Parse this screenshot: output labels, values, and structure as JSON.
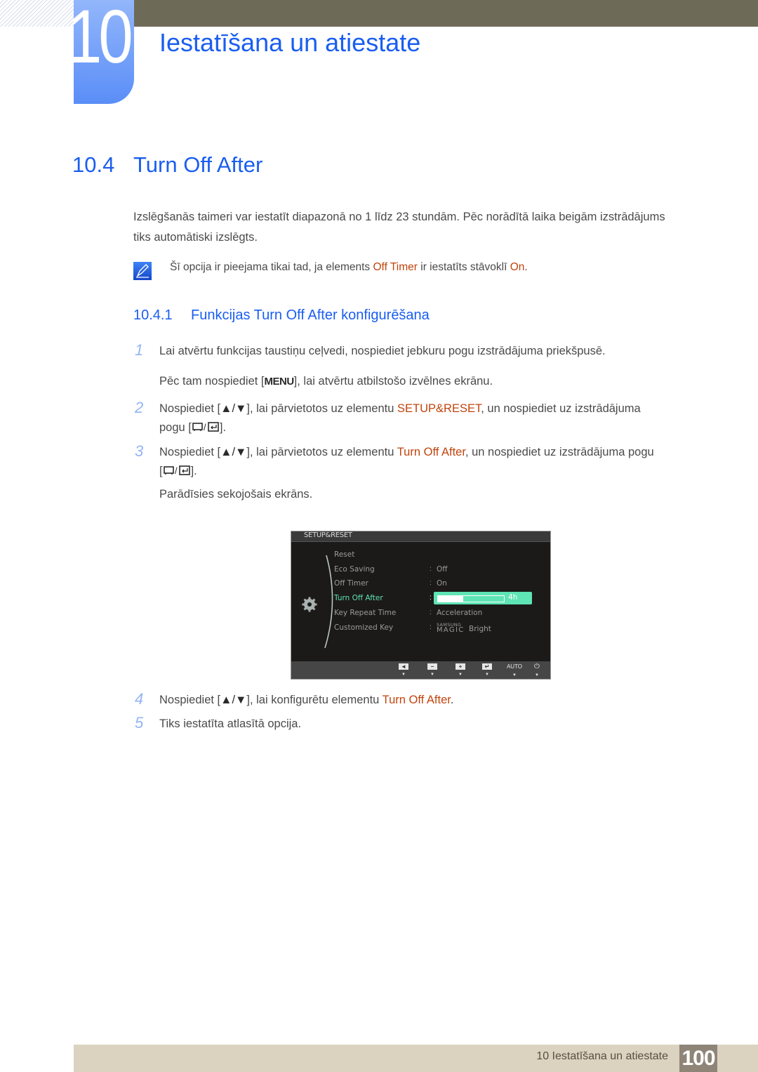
{
  "chapter": {
    "number": "10",
    "title": "Iestatīšana un atiestate"
  },
  "section": {
    "number": "10.4",
    "title": "Turn Off After"
  },
  "intro": {
    "line1": "Izslēgšanās taimeri var iestatīt diapazonā no 1 līdz 23 stundām. Pēc norādītā laika beigām izstrādājums",
    "line2": "tiks automātiski izslēgts."
  },
  "note": {
    "icon": "note-pencil-icon",
    "before": "Šī opcija ir pieejama tikai tad, ja elements ",
    "hl1": "Off Timer",
    "middle": " ir iestatīts stāvoklī ",
    "hl2": "On",
    "after": "."
  },
  "subsection": {
    "number": "10.4.1",
    "title": "Funkcijas Turn Off After konfigurēšana"
  },
  "steps": [
    {
      "num": "1",
      "text": "Lai atvērtu funkcijas taustiņu ceļvedi, nospiediet jebkuru pogu izstrādājuma priekšpusē.",
      "sub_before": "Pēc tam nospiediet [",
      "sub_key": "MENU",
      "sub_after": "], lai atvērtu atbilstošo izvēlnes ekrānu."
    },
    {
      "num": "2",
      "before": "Nospiediet [",
      "keys": "▲/▼",
      "mid": "], lai pārvietotos uz elementu ",
      "hl": "SETUP&RESET",
      "after": ", un nospiediet uz izstrādājuma",
      "line2_before": "pogu [",
      "line2_after": "]."
    },
    {
      "num": "3",
      "before": "Nospiediet [",
      "keys": "▲/▼",
      "mid": "], lai pārvietotos uz elementu ",
      "hl": "Turn Off After",
      "after": ", un nospiediet uz izstrādājuma pogu",
      "line2_before": "[",
      "line2_after": "].",
      "sub": "Parādīsies sekojošais ekrāns."
    },
    {
      "num": "4",
      "before": "Nospiediet [",
      "keys": "▲/▼",
      "mid": "], lai konfigurētu elementu ",
      "hl": "Turn Off After",
      "after": "."
    },
    {
      "num": "5",
      "text": "Tiks iestatīta atlasītā opcija."
    }
  ],
  "osd": {
    "header": "SETUP&RESET",
    "items": [
      {
        "label": "Reset",
        "value": ""
      },
      {
        "label": "Eco Saving",
        "value": "Off"
      },
      {
        "label": "Off Timer",
        "value": "On"
      },
      {
        "label": "Turn Off After",
        "value": "4h",
        "selected": true
      },
      {
        "label": "Key Repeat Time",
        "value": "Acceleration"
      },
      {
        "label": "Customized Key",
        "value": "Bright"
      }
    ],
    "slider": {
      "label": "4h",
      "fraction": 0.38
    },
    "magic": {
      "small": "SAMSUNG",
      "big": "MAGIC",
      "value": "Bright"
    },
    "buttons": [
      {
        "icon": "left-icon",
        "glyph": "◄"
      },
      {
        "icon": "minus-icon",
        "glyph": "−"
      },
      {
        "icon": "plus-icon",
        "glyph": "+"
      },
      {
        "icon": "enter-icon",
        "glyph": "↵"
      },
      {
        "icon": "auto-label",
        "label": "AUTO"
      },
      {
        "icon": "power-icon",
        "glyph": "⏻"
      }
    ],
    "arrow_glyph": "▼"
  },
  "footer": {
    "text": "10 Iestatīšana un atiestate",
    "page": "100"
  },
  "colors": {
    "accent_blue": "#1a5ef0",
    "highlight": "#c1440e",
    "osd_selected": "#5fe0b0",
    "footer_bg": "#dbd3bf",
    "page_badge": "#8e8478"
  }
}
